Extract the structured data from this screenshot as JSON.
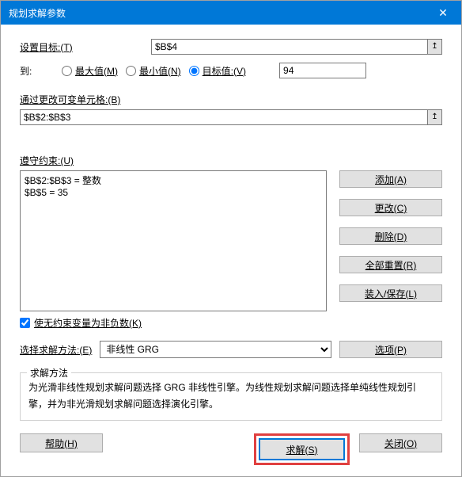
{
  "title": "规划求解参数",
  "labels": {
    "setTarget": "设置目标:(T)",
    "to": "到:",
    "max": "最大值(M)",
    "min": "最小值(N)",
    "targetValue": "目标值:(V)",
    "byChanging": "通过更改可变单元格:(B)",
    "subjectTo": "遵守约束:(U)",
    "makeNonNeg": "使无约束变量为非负数(K)",
    "selectMethod": "选择求解方法:(E)",
    "methodGroup": "求解方法",
    "methodDesc": "为光滑非线性规划求解问题选择 GRG 非线性引擎。为线性规划求解问题选择单纯线性规划引擎，并为非光滑规划求解问题选择演化引擎。"
  },
  "values": {
    "targetCell": "$B$4",
    "targetValue": "94",
    "changingCells": "$B$2:$B$3",
    "constraints": "$B$2:$B$3 = 整数\n$B$5 = 35",
    "methodSelected": "非线性 GRG"
  },
  "buttons": {
    "add": "添加(A)",
    "change": "更改(C)",
    "delete": "删除(D)",
    "resetAll": "全部重置(R)",
    "loadSave": "装入/保存(L)",
    "options": "选项(P)",
    "help": "帮助(H)",
    "solve": "求解(S)",
    "close": "关闭(O)"
  },
  "radioSelected": "targetValue"
}
